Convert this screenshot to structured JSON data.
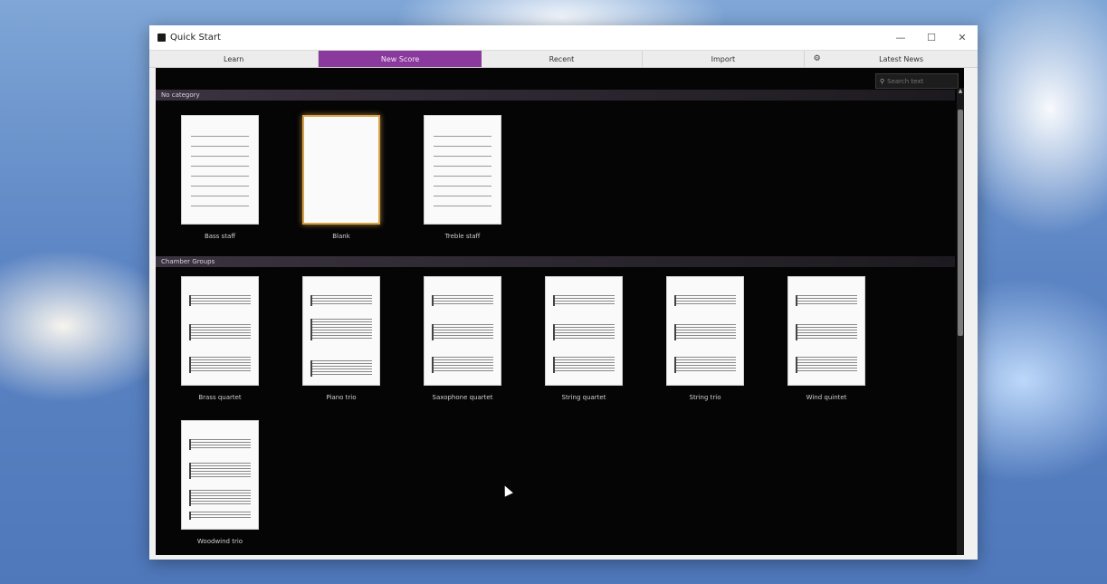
{
  "window": {
    "title": "Quick Start"
  },
  "tabs": [
    "Learn",
    "New Score",
    "Recent",
    "Import",
    "Latest News"
  ],
  "search": {
    "placeholder": "Search text"
  },
  "sections": [
    {
      "title": "No category",
      "items": [
        {
          "label": "Bass staff",
          "type": "staff"
        },
        {
          "label": "Blank",
          "type": "blank",
          "selected": true
        },
        {
          "label": "Treble staff",
          "type": "staff"
        }
      ]
    },
    {
      "title": "Chamber Groups",
      "items": [
        {
          "label": "Brass quartet",
          "type": "ensemble"
        },
        {
          "label": "Piano trio",
          "type": "ensemble"
        },
        {
          "label": "Saxophone quartet",
          "type": "ensemble"
        },
        {
          "label": "String quartet",
          "type": "ensemble"
        },
        {
          "label": "String trio",
          "type": "ensemble"
        },
        {
          "label": "Wind quintet",
          "type": "ensemble"
        },
        {
          "label": "Woodwind trio",
          "type": "ensemble"
        }
      ]
    }
  ],
  "icons": {
    "app": "app-icon",
    "minimize": "minimize-icon",
    "maximize": "maximize-icon",
    "close": "close-icon",
    "gear": "gear-icon",
    "search": "search-icon"
  },
  "colors": {
    "accent": "#8a3a9c",
    "selection": "#d7a24a",
    "background": "#050505"
  }
}
